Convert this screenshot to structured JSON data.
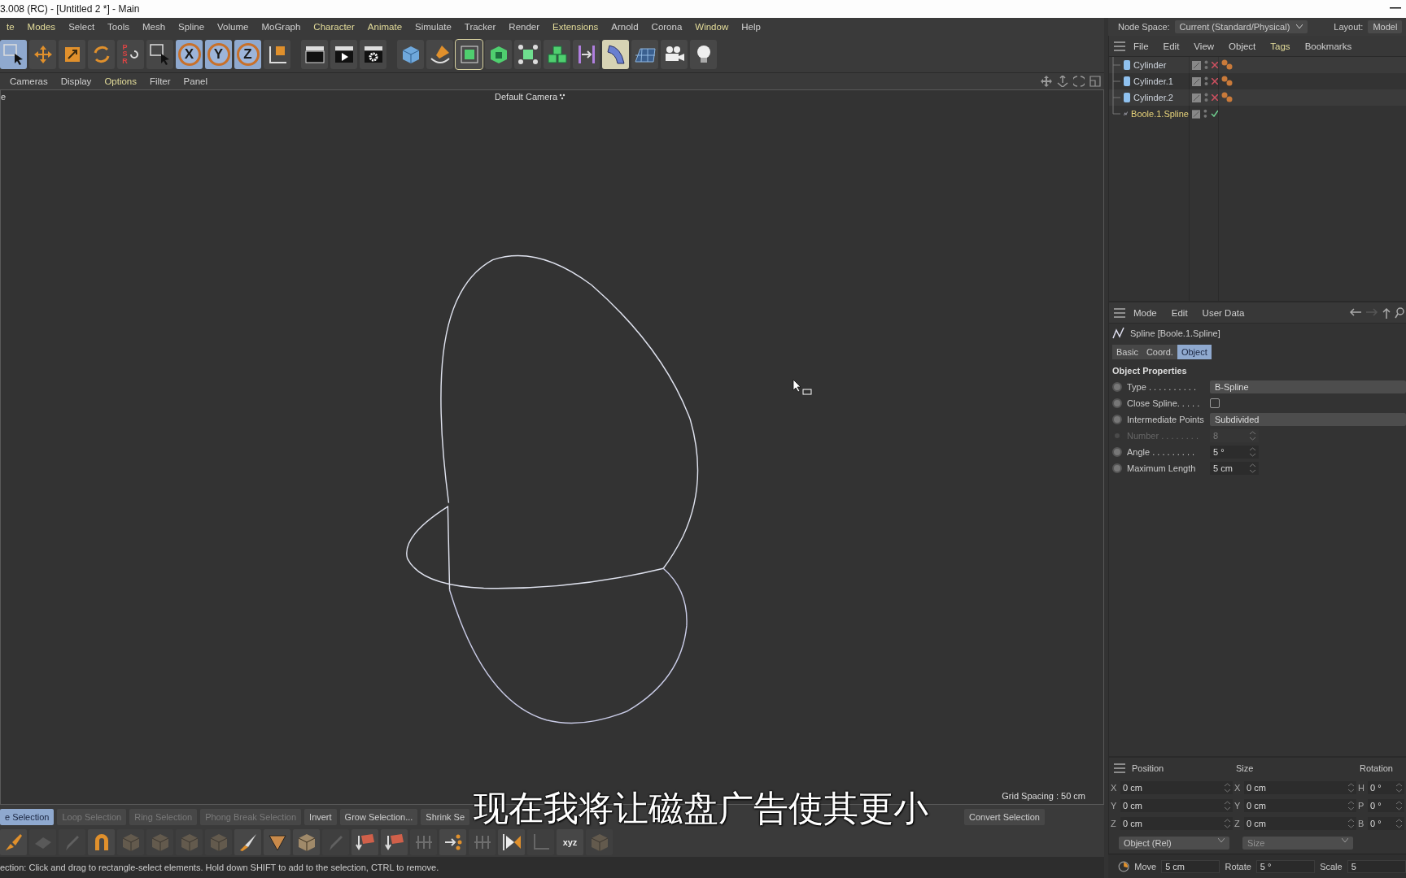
{
  "title_bar": {
    "title": "3.008 (RC) - [Untitled 2 *] - Main"
  },
  "menu": [
    {
      "label": "te",
      "highlighted": true
    },
    {
      "label": "Modes",
      "highlighted": true
    },
    {
      "label": "Select",
      "highlighted": false
    },
    {
      "label": "Tools",
      "highlighted": false
    },
    {
      "label": "Mesh",
      "highlighted": false
    },
    {
      "label": "Spline",
      "highlighted": false
    },
    {
      "label": "Volume",
      "highlighted": false
    },
    {
      "label": "MoGraph",
      "highlighted": false
    },
    {
      "label": "Character",
      "highlighted": true
    },
    {
      "label": "Animate",
      "highlighted": true
    },
    {
      "label": "Simulate",
      "highlighted": false
    },
    {
      "label": "Tracker",
      "highlighted": false
    },
    {
      "label": "Render",
      "highlighted": false
    },
    {
      "label": "Extensions",
      "highlighted": true
    },
    {
      "label": "Arnold",
      "highlighted": false
    },
    {
      "label": "Corona",
      "highlighted": false
    },
    {
      "label": "Window",
      "highlighted": true
    },
    {
      "label": "Help",
      "highlighted": false
    }
  ],
  "node_space": {
    "label": "Node Space:",
    "value": "Current (Standard/Physical)"
  },
  "layout": {
    "label": "Layout:",
    "value": "Model"
  },
  "toolbar": [
    {
      "kind": "select",
      "active": true
    },
    {
      "kind": "move",
      "active": false
    },
    {
      "kind": "scale",
      "active": false
    },
    {
      "kind": "rotate",
      "active": false
    },
    {
      "kind": "psr",
      "label": "PSR",
      "active": false
    },
    {
      "kind": "select",
      "active": false
    },
    {
      "kind": "axis",
      "label": "X",
      "active": true
    },
    {
      "kind": "axis",
      "label": "Y",
      "active": true
    },
    {
      "kind": "axis",
      "label": "Z",
      "active": true
    },
    {
      "kind": "coords",
      "active": false
    },
    {
      "kind": "clapper-frame",
      "active": false
    },
    {
      "kind": "clapper-play",
      "active": false
    },
    {
      "kind": "clapper-gear",
      "active": false
    },
    {
      "kind": "cube",
      "active": false
    },
    {
      "kind": "pen",
      "active": false
    },
    {
      "kind": "subdiv",
      "active": true
    },
    {
      "kind": "extrude",
      "active": false
    },
    {
      "kind": "cloner",
      "active": false
    },
    {
      "kind": "array",
      "active": false
    },
    {
      "kind": "symmetry",
      "active": false
    },
    {
      "kind": "bend",
      "active": true
    },
    {
      "kind": "floor",
      "active": false
    },
    {
      "kind": "camera",
      "active": false
    },
    {
      "kind": "light",
      "active": false
    }
  ],
  "viewport": {
    "menu": [
      {
        "label": "Cameras",
        "highlighted": false
      },
      {
        "label": "Display",
        "highlighted": false
      },
      {
        "label": "Options",
        "highlighted": true
      },
      {
        "label": "Filter",
        "highlighted": false
      },
      {
        "label": "Panel",
        "highlighted": false
      }
    ],
    "edge_label": "e",
    "camera": "Default Camera",
    "grid_spacing": "Grid Spacing : 50 cm"
  },
  "object_manager": {
    "menu": [
      {
        "label": "File",
        "highlighted": false
      },
      {
        "label": "Edit",
        "highlighted": false
      },
      {
        "label": "View",
        "highlighted": false
      },
      {
        "label": "Object",
        "highlighted": false
      },
      {
        "label": "Tags",
        "highlighted": true
      },
      {
        "label": "Bookmarks",
        "highlighted": false
      }
    ],
    "objects": [
      {
        "name": "Cylinder",
        "kind": "cylinder",
        "selected": false,
        "enabled": false,
        "tagged": true
      },
      {
        "name": "Cylinder.1",
        "kind": "cylinder",
        "selected": false,
        "enabled": false,
        "tagged": true
      },
      {
        "name": "Cylinder.2",
        "kind": "cylinder",
        "selected": false,
        "enabled": false,
        "tagged": true
      },
      {
        "name": "Boole.1.Spline",
        "kind": "spline",
        "selected": true,
        "enabled": true,
        "tagged": false
      }
    ]
  },
  "attributes": {
    "menu": [
      "Mode",
      "Edit",
      "User Data"
    ],
    "object_title": "Spline [Boole.1.Spline]",
    "tabs": [
      {
        "label": "Basic",
        "selected": false
      },
      {
        "label": "Coord.",
        "selected": false
      },
      {
        "label": "Object",
        "selected": true
      }
    ],
    "section": "Object Properties",
    "properties": [
      {
        "label": "Type . . . . . . . . . .",
        "kind": "dropdown",
        "value": "B-Spline",
        "disabled": false
      },
      {
        "label": "Close Spline. . . . .",
        "kind": "checkbox",
        "checked": false,
        "disabled": false
      },
      {
        "label": "Intermediate Points",
        "kind": "dropdown",
        "value": "Subdivided",
        "disabled": false
      },
      {
        "label": "Number . . . . . . . .",
        "kind": "number",
        "value": "8",
        "disabled": true
      },
      {
        "label": "Angle . . . . . . . . .",
        "kind": "number",
        "value": "5 °",
        "disabled": false
      },
      {
        "label": "Maximum Length",
        "kind": "number",
        "value": "5 cm",
        "disabled": false
      }
    ]
  },
  "coordinates": {
    "headers": [
      "Position",
      "Size",
      "Rotation"
    ],
    "rows": [
      {
        "axes": [
          "X",
          "X",
          "H"
        ],
        "values": [
          "0 cm",
          "0 cm",
          "0 °"
        ]
      },
      {
        "axes": [
          "Y",
          "Y",
          "P"
        ],
        "values": [
          "0 cm",
          "0 cm",
          "0 °"
        ]
      },
      {
        "axes": [
          "Z",
          "Z",
          "B"
        ],
        "values": [
          "0 cm",
          "0 cm",
          "0 °"
        ]
      }
    ],
    "dropdowns": [
      {
        "value": "Object (Rel)",
        "disabled": false
      },
      {
        "value": "Size",
        "disabled": true
      }
    ]
  },
  "snap_bar": [
    {
      "label": "Move",
      "value": "5 cm"
    },
    {
      "label": "Rotate",
      "value": "5 °"
    },
    {
      "label": "Scale",
      "value": "5"
    }
  ],
  "selection_buttons": [
    {
      "label": "e Selection",
      "disabled": false,
      "selected": true
    },
    {
      "label": "Loop Selection",
      "disabled": true,
      "selected": false
    },
    {
      "label": "Ring Selection",
      "disabled": true,
      "selected": false
    },
    {
      "label": "Phong Break Selection",
      "disabled": true,
      "selected": false
    },
    {
      "label": "Invert",
      "disabled": false,
      "selected": false
    },
    {
      "label": "Grow Selection...",
      "disabled": false,
      "selected": false
    },
    {
      "label": "Shrink Se",
      "disabled": false,
      "selected": false
    }
  ],
  "selection_buttons_right": [
    {
      "label": "Convert Selection",
      "disabled": false,
      "selected": false
    }
  ],
  "tool_icons": [
    {
      "kind": "brush",
      "disabled": false
    },
    {
      "kind": "plane",
      "disabled": true
    },
    {
      "kind": "pencil",
      "disabled": true
    },
    {
      "kind": "magnet",
      "disabled": false
    },
    {
      "kind": "box",
      "disabled": true
    },
    {
      "kind": "box",
      "disabled": true
    },
    {
      "kind": "box",
      "disabled": true
    },
    {
      "kind": "box",
      "disabled": true
    },
    {
      "kind": "knife",
      "disabled": false
    },
    {
      "kind": "shield",
      "disabled": false
    },
    {
      "kind": "box",
      "disabled": false
    },
    {
      "kind": "pencil",
      "disabled": true
    },
    {
      "kind": "tiles",
      "disabled": false
    },
    {
      "kind": "tiles",
      "disabled": false
    },
    {
      "kind": "bars",
      "disabled": true
    },
    {
      "kind": "dots",
      "disabled": false
    },
    {
      "kind": "bars",
      "disabled": true
    },
    {
      "kind": "play",
      "disabled": false
    },
    {
      "kind": "frame",
      "disabled": true
    },
    {
      "kind": "xyz",
      "label": "xyz",
      "disabled": false
    },
    {
      "kind": "box",
      "disabled": true
    }
  ],
  "status": "ection: Click and drag to rectangle-select elements. Hold down SHIFT to add to the selection, CTRL to remove.",
  "subtitle": "现在我将让磁盘广告使其更小"
}
